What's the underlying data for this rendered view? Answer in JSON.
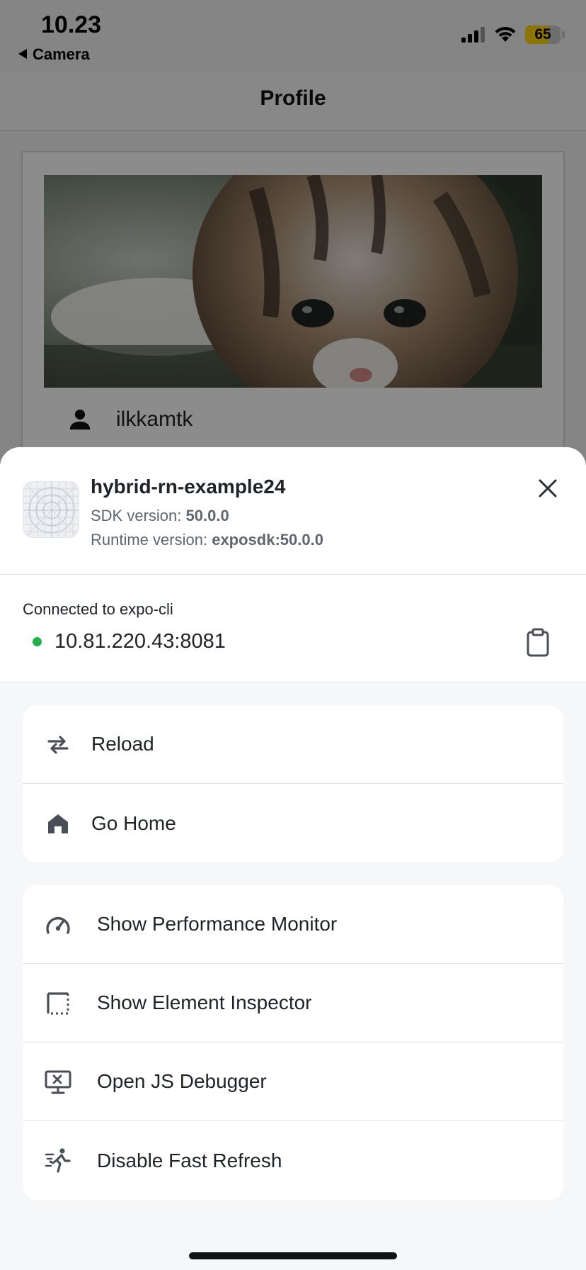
{
  "status_bar": {
    "time": "10.23",
    "back_app": "Camera",
    "battery_level": 65,
    "battery_label": "65"
  },
  "background_app": {
    "title": "Profile",
    "username": "ilkkamtk",
    "user_icon": "person-icon"
  },
  "dev_menu": {
    "app_name": "hybrid-rn-example24",
    "sdk_label": "SDK version:",
    "sdk_value": "50.0.0",
    "runtime_label": "Runtime version:",
    "runtime_value": "exposdk:50.0.0",
    "connected_label": "Connected to expo-cli",
    "server_address": "10.81.220.43:8081",
    "status_color": "#22b14c",
    "primary_items": [
      {
        "label": "Reload",
        "icon": "reload-icon"
      },
      {
        "label": "Go Home",
        "icon": "home-icon"
      }
    ],
    "tool_items": [
      {
        "label": "Show Performance Monitor",
        "icon": "speedometer-icon"
      },
      {
        "label": "Show Element Inspector",
        "icon": "inspector-icon"
      },
      {
        "label": "Open JS Debugger",
        "icon": "debugger-icon"
      },
      {
        "label": "Disable Fast Refresh",
        "icon": "running-person-icon"
      }
    ]
  }
}
